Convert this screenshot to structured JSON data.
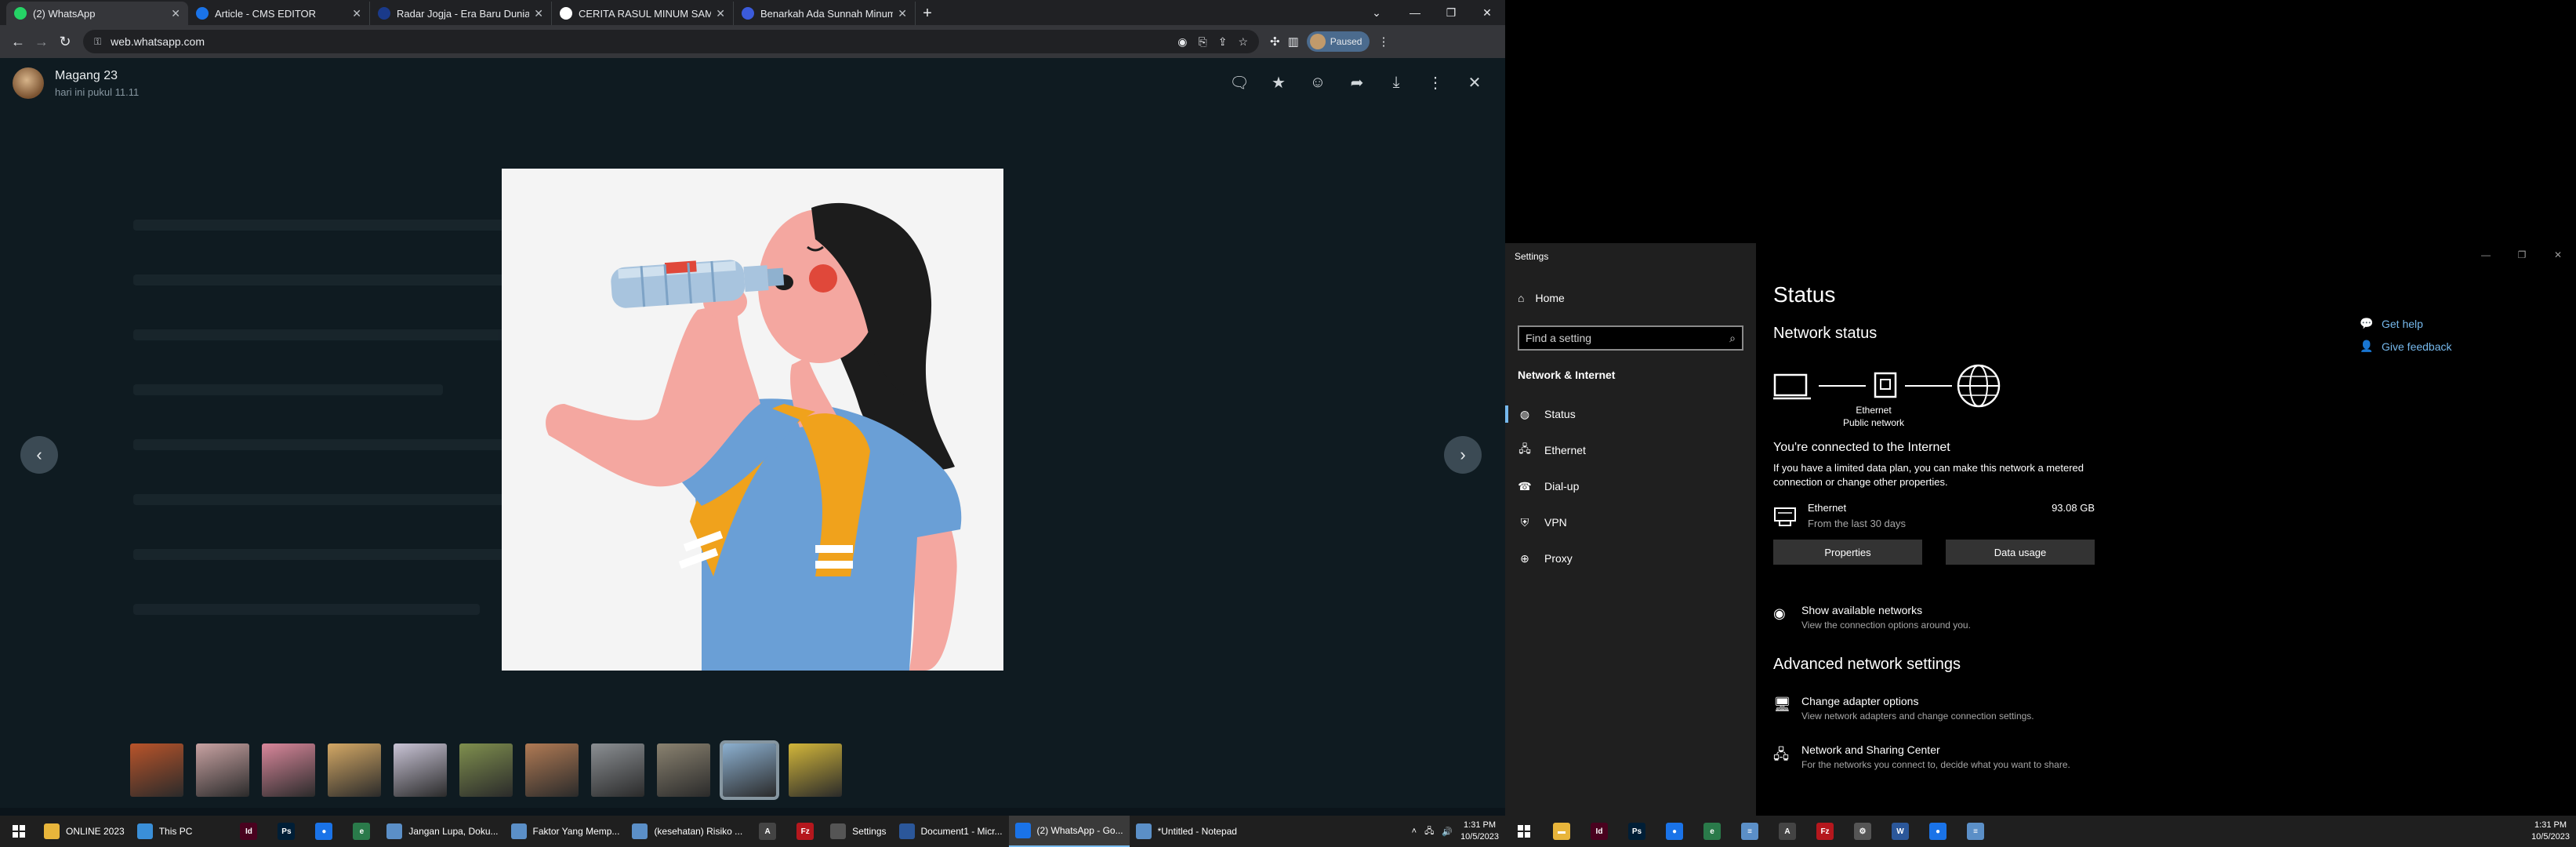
{
  "chrome": {
    "tabs": [
      {
        "title": "(2) WhatsApp",
        "color": "#25d366",
        "active": true
      },
      {
        "title": "Article - CMS EDITOR",
        "color": "#1a73e8",
        "active": false
      },
      {
        "title": "Radar Jogja - Era Baru Dunia Dig",
        "color": "#1a3a8a",
        "active": false
      },
      {
        "title": "CERITA RASUL MINUM SAMBIL B",
        "color": "#ffffff",
        "active": false
      },
      {
        "title": "Benarkah Ada Sunnah Minum Ai",
        "color": "#3b5bdb",
        "active": false
      }
    ],
    "url": "web.whatsapp.com",
    "profile_label": "Paused"
  },
  "whatsapp": {
    "contact_name": "Magang 23",
    "time_label": "hari ini pukul 11.11",
    "thumbnails": [
      {
        "color": "#b9542a",
        "selected": false
      },
      {
        "color": "#c8a2a2",
        "selected": false
      },
      {
        "color": "#d9879b",
        "selected": false
      },
      {
        "color": "#d3a865",
        "selected": false
      },
      {
        "color": "#c9c4d6",
        "selected": false
      },
      {
        "color": "#7f8f4e",
        "selected": false
      },
      {
        "color": "#b07a54",
        "selected": false
      },
      {
        "color": "#8b8f93",
        "selected": false
      },
      {
        "color": "#8a8270",
        "selected": false
      },
      {
        "color": "#8cb0d0",
        "selected": true
      },
      {
        "color": "#d2b63a",
        "selected": false
      }
    ]
  },
  "taskbar_left": {
    "items": [
      {
        "label": "ONLINE 2023",
        "icon": "folder-icon",
        "color": "#e8b53b",
        "wide": false
      },
      {
        "label": "This PC",
        "icon": "computer-icon",
        "color": "#3a8fd8",
        "wide": false
      }
    ],
    "pinned": [
      {
        "icon": "indesign-icon",
        "glyph": "Id",
        "color": "#49021f"
      },
      {
        "icon": "photoshop-icon",
        "glyph": "Ps",
        "color": "#001e36"
      },
      {
        "icon": "chrome-icon",
        "glyph": "●",
        "color": "#1a73e8"
      },
      {
        "icon": "edge-icon",
        "glyph": "e",
        "color": "#2a7a4a"
      }
    ],
    "docs": [
      {
        "label": "Jangan Lupa, Doku...",
        "icon": "notepad-icon",
        "color": "#5b8fc7"
      },
      {
        "label": "Faktor Yang Memp...",
        "icon": "notepad-icon",
        "color": "#5b8fc7"
      },
      {
        "label": "(kesehatan) Risiko ...",
        "icon": "notepad-icon",
        "color": "#5b8fc7"
      }
    ],
    "pinned2": [
      {
        "icon": "acrobat-icon",
        "glyph": "A",
        "color": "#444"
      },
      {
        "icon": "filezilla-icon",
        "glyph": "Fz",
        "color": "#b5171d"
      }
    ],
    "apps": [
      {
        "label": "Settings",
        "icon": "gear-icon",
        "color": "#555",
        "active": false
      },
      {
        "label": "Document1 - Micr...",
        "icon": "word-icon",
        "color": "#2b579a",
        "active": false
      },
      {
        "label": "(2) WhatsApp - Go...",
        "icon": "chrome-icon",
        "color": "#1a73e8",
        "active": true
      },
      {
        "label": "*Untitled - Notepad",
        "icon": "notepad-icon",
        "color": "#5b8fc7",
        "active": false
      }
    ],
    "time": "1:31 PM",
    "date": "10/5/2023"
  },
  "settings": {
    "window_title": "Settings",
    "home_label": "Home",
    "search_placeholder": "Find a setting",
    "category": "Network & Internet",
    "nav": [
      {
        "label": "Status",
        "icon": "status-icon",
        "glyph": "◍",
        "selected": true
      },
      {
        "label": "Ethernet",
        "icon": "ethernet-icon",
        "glyph": "🖧",
        "selected": false
      },
      {
        "label": "Dial-up",
        "icon": "dialup-icon",
        "glyph": "☎",
        "selected": false
      },
      {
        "label": "VPN",
        "icon": "vpn-icon",
        "glyph": "⛨",
        "selected": false
      },
      {
        "label": "Proxy",
        "icon": "proxy-icon",
        "glyph": "⊕",
        "selected": false
      }
    ],
    "page_title": "Status",
    "network_status": "Network status",
    "diagram_label_1": "Ethernet",
    "diagram_label_2": "Public network",
    "connected_text": "You're connected to the Internet",
    "limited_text": "If you have a limited data plan, you can make this network a metered connection or change other properties.",
    "ethernet_name": "Ethernet",
    "ethernet_sub": "From the last 30 days",
    "ethernet_usage": "93.08 GB",
    "properties_label": "Properties",
    "data_usage_label": "Data usage",
    "show_networks": "Show available networks",
    "show_networks_sub": "View the connection options around you.",
    "advanced_title": "Advanced network settings",
    "adapter_title": "Change adapter options",
    "adapter_sub": "View network adapters and change connection settings.",
    "sharing_title": "Network and Sharing Center",
    "sharing_sub": "For the networks you connect to, decide what you want to share.",
    "get_help": "Get help",
    "give_feedback": "Give feedback"
  },
  "taskbar_right": {
    "icons": [
      {
        "icon": "file-explorer-icon",
        "glyph": "▬",
        "color": "#e8b53b"
      },
      {
        "icon": "indesign-icon",
        "glyph": "Id",
        "color": "#49021f"
      },
      {
        "icon": "photoshop-icon",
        "glyph": "Ps",
        "color": "#001e36"
      },
      {
        "icon": "chrome-icon",
        "glyph": "●",
        "color": "#1a73e8"
      },
      {
        "icon": "edge-icon",
        "glyph": "e",
        "color": "#2a7a4a"
      },
      {
        "icon": "notepad-icon",
        "glyph": "≡",
        "color": "#5b8fc7"
      },
      {
        "icon": "acrobat-icon",
        "glyph": "A",
        "color": "#444"
      },
      {
        "icon": "filezilla-icon",
        "glyph": "Fz",
        "color": "#b5171d"
      },
      {
        "icon": "gear-icon",
        "glyph": "⚙",
        "color": "#555"
      },
      {
        "icon": "word-icon",
        "glyph": "W",
        "color": "#2b579a"
      },
      {
        "icon": "chrome-icon",
        "glyph": "●",
        "color": "#1a73e8"
      },
      {
        "icon": "notepad-icon",
        "glyph": "≡",
        "color": "#5b8fc7"
      }
    ],
    "time": "1:31 PM",
    "date": "10/5/2023"
  }
}
